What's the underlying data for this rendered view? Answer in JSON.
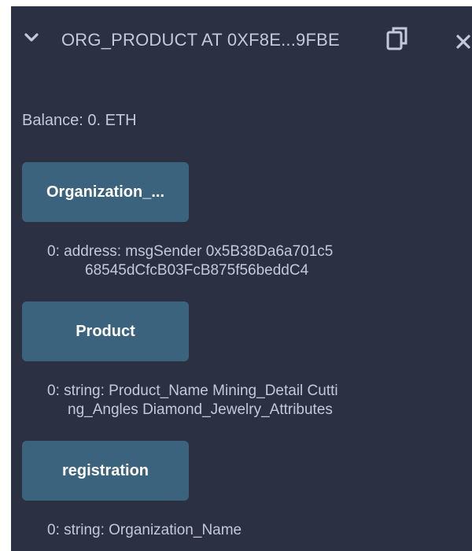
{
  "header": {
    "title": "ORG_PRODUCT AT 0XF8E...9FBE"
  },
  "balance": "Balance: 0. ETH",
  "functions": [
    {
      "label": "Organization_...",
      "output_line1": "0:  address: msgSender 0x5B38Da6a701c5",
      "output_line2": "68545dCfcB03FcB875f56beddC4"
    },
    {
      "label": "Product",
      "output_line1": "0:  string: Product_Name Mining_Detail Cutti",
      "output_line2": "ng_Angles Diamond_Jewelry_Attributes"
    },
    {
      "label": "registration",
      "output_line1": "0:  string: Organization_Name",
      "output_line2": ""
    }
  ],
  "colors": {
    "panel_bg": "#2b3042",
    "button_bg": "#3c637e",
    "text": "#c3c9da"
  },
  "icons": {
    "collapse": "chevron-down-icon",
    "copy": "copy-icon",
    "close": "close-icon"
  }
}
